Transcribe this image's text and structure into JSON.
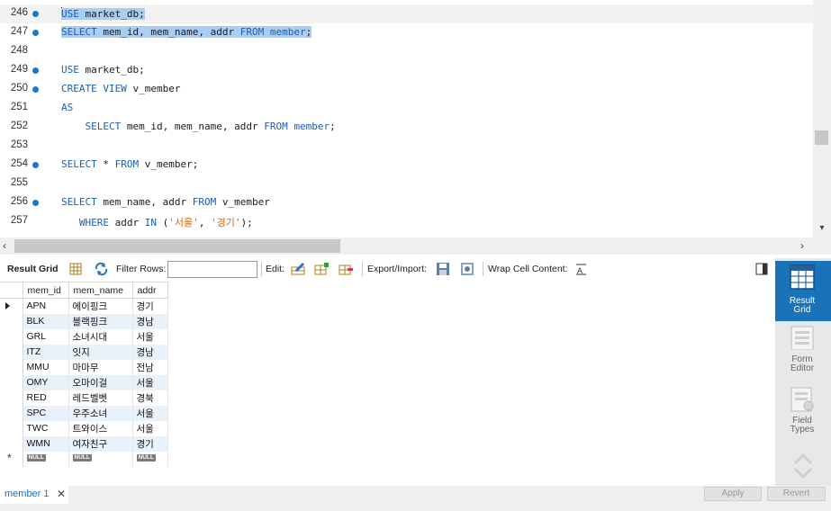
{
  "editor": {
    "lines": [
      {
        "num": "246",
        "dot": true,
        "current": true,
        "tokens": [
          {
            "t": "USE",
            "k": "kw",
            "sel": true
          },
          {
            "t": " market_db;",
            "k": "",
            "sel": true
          }
        ]
      },
      {
        "num": "247",
        "dot": true,
        "tokens": [
          {
            "t": "SELECT",
            "k": "kw",
            "sel": true
          },
          {
            "t": " mem_id, mem_name, addr ",
            "k": "",
            "sel": true
          },
          {
            "t": "FROM",
            "k": "kw",
            "sel": true
          },
          {
            "t": " ",
            "k": "",
            "sel": true
          },
          {
            "t": "member",
            "k": "kw",
            "sel": true
          },
          {
            "t": ";",
            "k": "",
            "sel": true
          }
        ]
      },
      {
        "num": "248",
        "dot": false,
        "tokens": []
      },
      {
        "num": "249",
        "dot": true,
        "tokens": [
          {
            "t": "USE",
            "k": "kw"
          },
          {
            "t": " market_db;",
            "k": ""
          }
        ]
      },
      {
        "num": "250",
        "dot": true,
        "tokens": [
          {
            "t": "CREATE",
            "k": "kw"
          },
          {
            "t": " ",
            "k": ""
          },
          {
            "t": "VIEW",
            "k": "kw"
          },
          {
            "t": " v_member",
            "k": ""
          }
        ]
      },
      {
        "num": "251",
        "dot": false,
        "tokens": [
          {
            "t": "AS",
            "k": "kw"
          }
        ]
      },
      {
        "num": "252",
        "dot": false,
        "tokens": [
          {
            "t": "    ",
            "k": ""
          },
          {
            "t": "SELECT",
            "k": "kw"
          },
          {
            "t": " mem_id, mem_name, addr ",
            "k": ""
          },
          {
            "t": "FROM",
            "k": "kw"
          },
          {
            "t": " ",
            "k": ""
          },
          {
            "t": "member",
            "k": "kw"
          },
          {
            "t": ";",
            "k": ""
          }
        ]
      },
      {
        "num": "253",
        "dot": false,
        "tokens": []
      },
      {
        "num": "254",
        "dot": true,
        "tokens": [
          {
            "t": "SELECT",
            "k": "kw"
          },
          {
            "t": " * ",
            "k": ""
          },
          {
            "t": "FROM",
            "k": "kw"
          },
          {
            "t": " v_member;",
            "k": ""
          }
        ]
      },
      {
        "num": "255",
        "dot": false,
        "tokens": []
      },
      {
        "num": "256",
        "dot": true,
        "tokens": [
          {
            "t": "SELECT",
            "k": "kw"
          },
          {
            "t": " mem_name, addr ",
            "k": ""
          },
          {
            "t": "FROM",
            "k": "kw"
          },
          {
            "t": " v_member",
            "k": ""
          }
        ]
      },
      {
        "num": "257",
        "dot": false,
        "tokens": [
          {
            "t": "   ",
            "k": ""
          },
          {
            "t": "WHERE",
            "k": "kw"
          },
          {
            "t": " addr ",
            "k": ""
          },
          {
            "t": "IN",
            "k": "kw"
          },
          {
            "t": " (",
            "k": ""
          },
          {
            "t": "'서울'",
            "k": "str"
          },
          {
            "t": ", ",
            "k": ""
          },
          {
            "t": "'경기'",
            "k": "str"
          },
          {
            "t": ");",
            "k": ""
          }
        ]
      }
    ]
  },
  "toolbar": {
    "result_grid_label": "Result Grid",
    "filter_rows_label": "Filter Rows:",
    "filter_value": "",
    "edit_label": "Edit:",
    "export_import_label": "Export/Import:",
    "wrap_cell_label": "Wrap Cell Content:"
  },
  "grid": {
    "columns": [
      "mem_id",
      "mem_name",
      "addr"
    ],
    "rows": [
      [
        "APN",
        "에이핑크",
        "경기"
      ],
      [
        "BLK",
        "블랙핑크",
        "경남"
      ],
      [
        "GRL",
        "소녀시대",
        "서울"
      ],
      [
        "ITZ",
        "잇지",
        "경남"
      ],
      [
        "MMU",
        "마마무",
        "전남"
      ],
      [
        "OMY",
        "오마이걸",
        "서울"
      ],
      [
        "RED",
        "레드벨벳",
        "경북"
      ],
      [
        "SPC",
        "우주소녀",
        "서울"
      ],
      [
        "TWC",
        "트와이스",
        "서울"
      ],
      [
        "WMN",
        "여자친구",
        "경기"
      ]
    ],
    "null_label": "NULL"
  },
  "side_panel": {
    "result_grid": "Result\nGrid",
    "form_editor": "Form\nEditor",
    "field_types": "Field\nTypes"
  },
  "bottom": {
    "tab_label": "member 1",
    "close_glyph": "✕",
    "apply_label": "Apply",
    "revert_label": "Revert"
  },
  "colors": {
    "keyword": "#1a5fb4",
    "string": "#d46a0d",
    "selection": "#a9cdf3",
    "breakpoint_dot": "#1d78c6",
    "active_panel": "#1a73b8",
    "alt_row": "#e9f1fb"
  }
}
